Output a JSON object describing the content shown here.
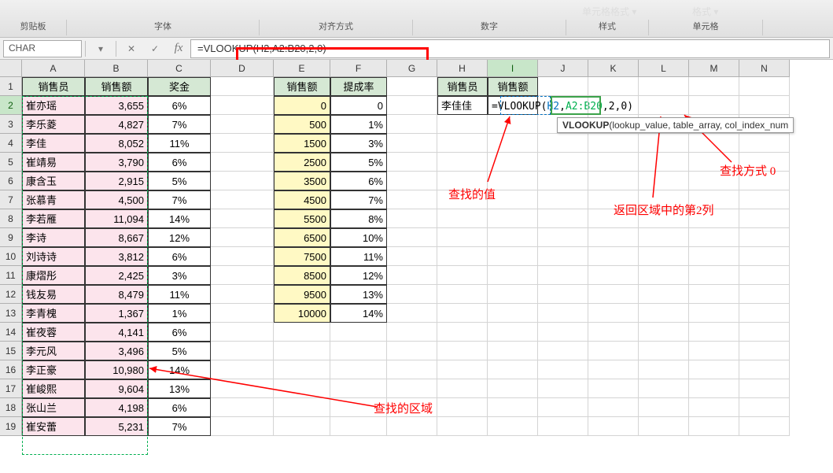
{
  "ribbon_groups": {
    "g1": "剪贴板",
    "g2": "字体",
    "g3": "对齐方式",
    "g4": "数字",
    "g5": "样式",
    "g6": "单元格"
  },
  "ribbon_items": {
    "cellfmt": "单元格格式 ▾",
    "fmt": "格式 ▾"
  },
  "name_box": "CHAR",
  "fx": "fx",
  "formula": "=VLOOKUP(H2,A2:B20,2,0)",
  "columns": [
    "A",
    "B",
    "C",
    "D",
    "E",
    "F",
    "G",
    "H",
    "I",
    "J",
    "K",
    "L",
    "M",
    "N"
  ],
  "row_nums": [
    "1",
    "2",
    "3",
    "4",
    "5",
    "6",
    "7",
    "8",
    "9",
    "10",
    "11",
    "12",
    "13",
    "14",
    "15",
    "16",
    "17",
    "18",
    "19"
  ],
  "hdr": {
    "A": "销售员",
    "B": "销售额",
    "C": "奖金",
    "E": "销售额",
    "F": "提成率",
    "H": "销售员",
    "I": "销售额"
  },
  "sales": [
    {
      "n": "崔亦瑶",
      "a": "3,655",
      "b": "6%"
    },
    {
      "n": "李乐菱",
      "a": "4,827",
      "b": "7%"
    },
    {
      "n": "李佳",
      "a": "8,052",
      "b": "11%"
    },
    {
      "n": "崔靖易",
      "a": "3,790",
      "b": "6%"
    },
    {
      "n": "康含玉",
      "a": "2,915",
      "b": "5%"
    },
    {
      "n": "张慕青",
      "a": "4,500",
      "b": "7%"
    },
    {
      "n": "李若雁",
      "a": "11,094",
      "b": "14%"
    },
    {
      "n": "李诗",
      "a": "8,667",
      "b": "12%"
    },
    {
      "n": "刘诗诗",
      "a": "3,812",
      "b": "6%"
    },
    {
      "n": "康熠彤",
      "a": "2,425",
      "b": "3%"
    },
    {
      "n": "钱友易",
      "a": "8,479",
      "b": "11%"
    },
    {
      "n": "李青槐",
      "a": "1,367",
      "b": "1%"
    },
    {
      "n": "崔夜蓉",
      "a": "4,141",
      "b": "6%"
    },
    {
      "n": "李元风",
      "a": "3,496",
      "b": "5%"
    },
    {
      "n": "李正豪",
      "a": "10,980",
      "b": "14%"
    },
    {
      "n": "崔峻熙",
      "a": "9,604",
      "b": "13%"
    },
    {
      "n": "张山兰",
      "a": "4,198",
      "b": "6%"
    },
    {
      "n": "崔安蕾",
      "a": "5,231",
      "b": "7%"
    }
  ],
  "comm": [
    {
      "e": "0",
      "f": "0"
    },
    {
      "e": "500",
      "f": "1%"
    },
    {
      "e": "1500",
      "f": "3%"
    },
    {
      "e": "2500",
      "f": "5%"
    },
    {
      "e": "3500",
      "f": "6%"
    },
    {
      "e": "4500",
      "f": "7%"
    },
    {
      "e": "5500",
      "f": "8%"
    },
    {
      "e": "6500",
      "f": "10%"
    },
    {
      "e": "7500",
      "f": "11%"
    },
    {
      "e": "8500",
      "f": "12%"
    },
    {
      "e": "9500",
      "f": "13%"
    },
    {
      "e": "10000",
      "f": "14%"
    }
  ],
  "H2": "李佳佳",
  "I2_parts": {
    "prefix": "=VLOOKUP(",
    "a1": "H2",
    "c1": ",",
    "a2": "A2:B20",
    "c2": ",",
    "a3": "2,0)",
    "close": ""
  },
  "tooltip": {
    "bold": "VLOOKUP",
    "rest": "(lookup_value, table_array, col_index_num"
  },
  "annotations": {
    "lookup_value": "查找的值",
    "lookup_mode": "查找方式 0",
    "return_col": "返回区域中的第2列",
    "lookup_range": "查找的区域"
  }
}
